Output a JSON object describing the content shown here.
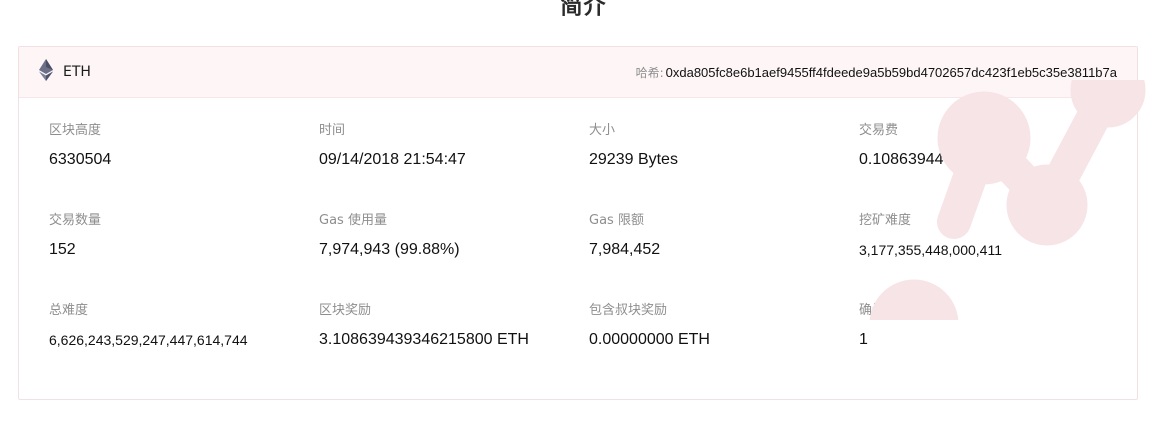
{
  "page": {
    "title": "简介"
  },
  "header": {
    "coin": {
      "name": "ETH",
      "icon": "ethereum-icon"
    },
    "hash": {
      "label": "哈希:",
      "value": "0xda805fc8e6b1aef9455ff4fdeede9a5b59bd4702657dc423f1eb5c35e3811b7a"
    }
  },
  "stats": [
    {
      "label": "区块高度",
      "value": "6330504"
    },
    {
      "label": "时间",
      "value": "09/14/2018 21:54:47"
    },
    {
      "label": "大小",
      "value": "29239 Bytes"
    },
    {
      "label": "交易费",
      "value": "0.10863944 ETH"
    },
    {
      "label": "交易数量",
      "value": "152"
    },
    {
      "label": "Gas 使用量",
      "value": "7,974,943 (99.88%)"
    },
    {
      "label": "Gas 限额",
      "value": "7,984,452"
    },
    {
      "label": "挖矿难度",
      "value": "3,177,355,448,000,411"
    },
    {
      "label": "总难度",
      "value": "6,626,243,529,247,447,614,744"
    },
    {
      "label": "区块奖励",
      "value": "3.108639439346215800 ETH"
    },
    {
      "label": "包含叔块奖励",
      "value": "0.00000000 ETH"
    },
    {
      "label": "确认数",
      "value": "1"
    }
  ],
  "colors": {
    "accent_pink": "#fdf5f6",
    "watermark": "#f7e4e7",
    "border": "#f2e1e4"
  }
}
